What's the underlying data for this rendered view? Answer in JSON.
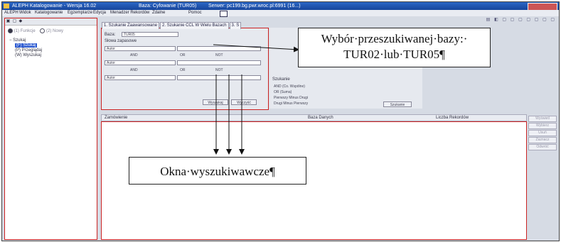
{
  "window": {
    "title": "ALEPH Katalogowanie - Wersja 16.02",
    "base": "Baza: Cyfowanie (TUR05)",
    "server": "Serwer: pc199.bg.pwr.wroc.pl:6991 (16...)"
  },
  "menu": [
    "ALEPH",
    "Widok",
    "Katalogowanie",
    "Egzemplarze",
    "Edycja",
    "Menadzer Rekordów",
    "Zdalne",
    "Pomoc",
    "?"
  ],
  "left_panel": {
    "radios": [
      "(1) Funkcje",
      "(2) Nowy"
    ],
    "tree_root": "Szukaj",
    "tree_items": [
      "(F) Szukaj",
      "(P) Przeglądaj",
      "(W) Wyszukaj"
    ]
  },
  "search": {
    "tabs": [
      "1. Szukanie Zaawansowane",
      "2. Szukanie CCL W Wielu Bazach",
      "3. S"
    ],
    "base_label": "Baza:",
    "base_value": "TUR05",
    "synonyms": "Słowa zapasowe",
    "field_value": "Autor",
    "operators": [
      "AND",
      "OR",
      "NOT"
    ],
    "search_button": "Wyszukaj",
    "clear_button": "Wyczyść"
  },
  "right_form": {
    "combine_label": "Szukanie",
    "options": [
      "AND (Co. Wspólne)",
      "OR (Suma)",
      "Pierwszy Minus Drugi",
      "Drugi Minus Pierwszy"
    ],
    "button": "Szukanie"
  },
  "results": {
    "columns": [
      "Zamówienie",
      "Baza Danych",
      "Liczba Rekordów"
    ],
    "side_buttons": [
      "Wyświetl",
      "Wybierz",
      "Usuń",
      "Zaznacz",
      "Odwróć"
    ]
  },
  "callouts": {
    "database": [
      "Wybór·przeszukiwanej·bazy:·",
      "TUR02·lub·TUR05¶"
    ],
    "windows": "Okna·wyszukiwawcze¶"
  }
}
